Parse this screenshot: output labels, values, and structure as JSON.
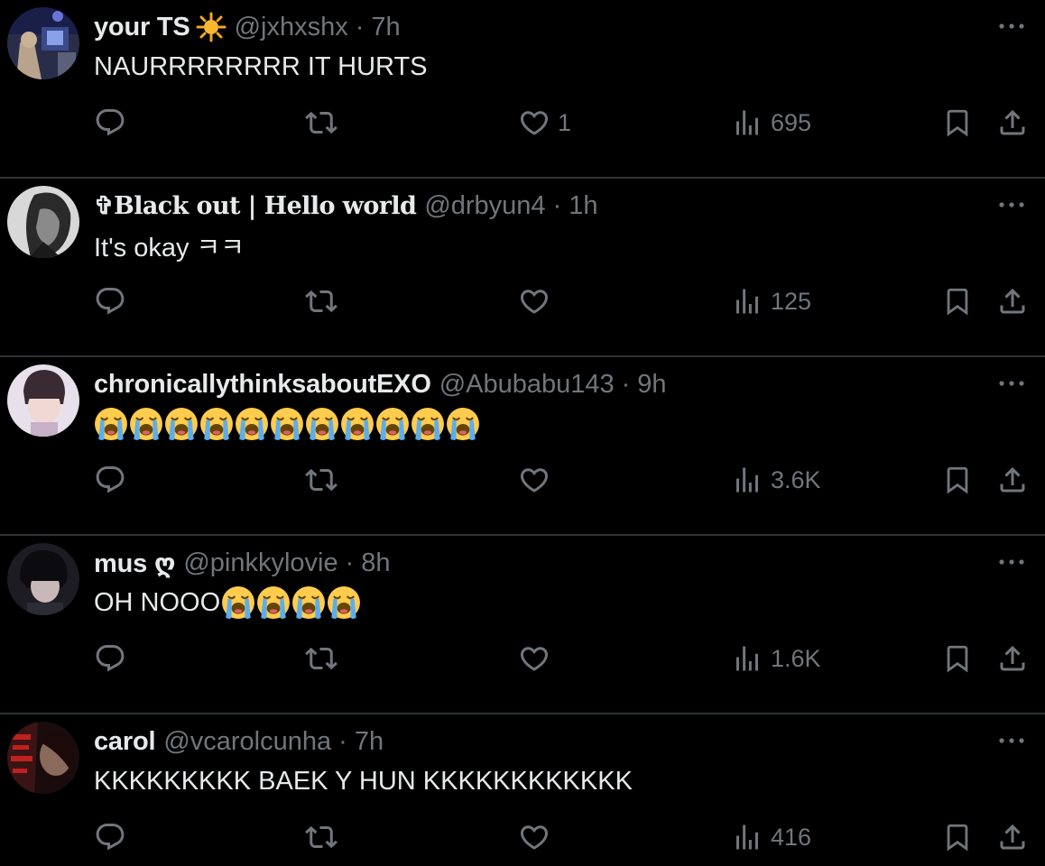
{
  "colors": {
    "background": "#000000",
    "text_primary": "#e7e9ea",
    "text_secondary": "#71767b",
    "divider": "#2f3336"
  },
  "icons": [
    "reply-icon",
    "retweet-icon",
    "like-icon",
    "views-icon",
    "bookmark-icon",
    "share-icon",
    "more-icon"
  ],
  "tweets": [
    {
      "name": "your TS",
      "name_badge": "sun-emoji",
      "handle": "@jxhxshx",
      "separator": "·",
      "time": "7h",
      "text": "NAURRRRRRRR IT HURTS",
      "emoji_count": 0,
      "likes": "1",
      "views": "695"
    },
    {
      "name": "✞Black out | Hello world",
      "handle": "@drbyun4",
      "separator": "·",
      "time": "1h",
      "text": "It's okay ㅋㅋ",
      "emoji_count": 0,
      "likes": "",
      "views": "125"
    },
    {
      "name": "chronicallythinksaboutEXO",
      "handle": "@Abubabu143",
      "separator": "·",
      "time": "9h",
      "text": "",
      "emoji": "loudly-crying-face",
      "emoji_count": 11,
      "likes": "",
      "views": "3.6K"
    },
    {
      "name": "mus ღ",
      "handle": "@pinkkylovie",
      "separator": "·",
      "time": "8h",
      "text": "OH NOOO",
      "emoji": "loudly-crying-face",
      "emoji_count": 4,
      "likes": "",
      "views": "1.6K"
    },
    {
      "name": "carol",
      "handle": "@vcarolcunha",
      "separator": "·",
      "time": "7h",
      "text": "KKKKKKKKK BAEK Y HUN KKKKKKKKKKKK",
      "emoji_count": 0,
      "likes": "",
      "views": "416"
    }
  ]
}
